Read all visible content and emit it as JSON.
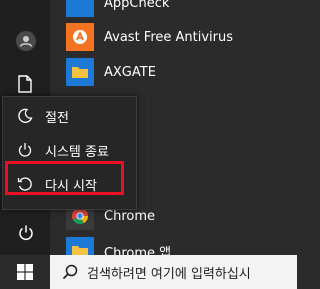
{
  "apps": [
    {
      "name": "AppCheck",
      "icon": "appcheck-icon",
      "color": "#1e78d6"
    },
    {
      "name": "Avast Free Antivirus",
      "icon": "avast-icon",
      "color": "#f37321"
    },
    {
      "name": "AXGATE",
      "icon": "folder-icon",
      "color": "#1e78d6"
    },
    {
      "name": "Chrome",
      "icon": "chrome-icon",
      "color": "#3a3a3a"
    },
    {
      "name": "Chrome 앱",
      "icon": "folder-icon",
      "color": "#1e78d6"
    }
  ],
  "power_menu": {
    "items": [
      {
        "label": "절전",
        "icon": "sleep-moon-icon"
      },
      {
        "label": "시스템 종료",
        "icon": "power-icon"
      },
      {
        "label": "다시 시작",
        "icon": "restart-icon"
      }
    ],
    "highlighted": "다시 시작",
    "highlight_color": "#e81123"
  },
  "taskbar": {
    "search_placeholder": "검색하려면 여기에 입력하십시"
  }
}
